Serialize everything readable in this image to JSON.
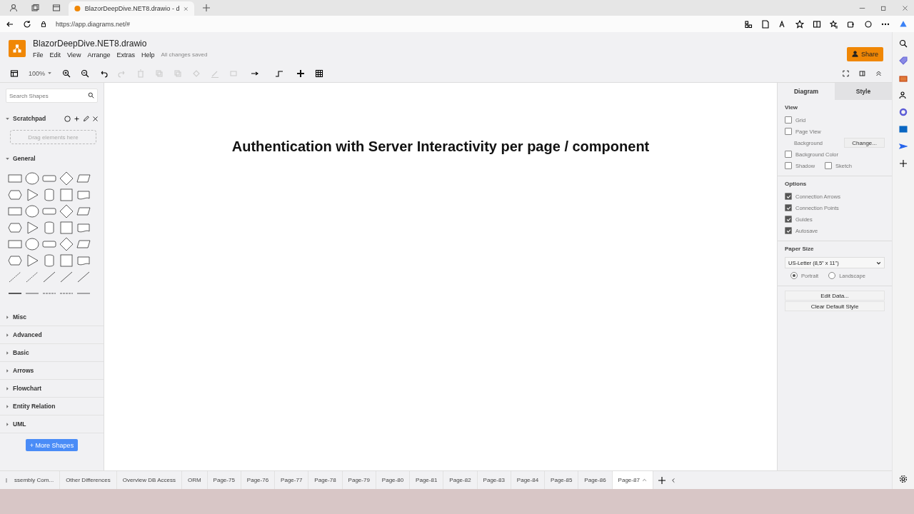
{
  "browser": {
    "tab_title": "BlazorDeepDive.NET8.drawio - d",
    "url": "https://app.diagrams.net/#"
  },
  "app": {
    "title": "BlazorDeepDive.NET8.drawio",
    "menu": [
      "File",
      "Edit",
      "View",
      "Arrange",
      "Extras",
      "Help"
    ],
    "status": "All changes saved",
    "zoom": "100%",
    "share": "Share"
  },
  "sidebar": {
    "search_placeholder": "Search Shapes",
    "scratchpad": {
      "title": "Scratchpad",
      "expanded": true,
      "hint": "Drag elements here"
    },
    "general": {
      "title": "General",
      "expanded": true
    },
    "categories": [
      {
        "label": "Misc",
        "expanded": false
      },
      {
        "label": "Advanced",
        "expanded": false
      },
      {
        "label": "Basic",
        "expanded": false
      },
      {
        "label": "Arrows",
        "expanded": false
      },
      {
        "label": "Flowchart",
        "expanded": false
      },
      {
        "label": "Entity Relation",
        "expanded": false
      },
      {
        "label": "UML",
        "expanded": false
      }
    ],
    "more_shapes": "+ More Shapes"
  },
  "canvas": {
    "heading": "Authentication with Server Interactivity per page / component"
  },
  "format_panel": {
    "tabs": [
      {
        "label": "Diagram",
        "selected": true
      },
      {
        "label": "Style",
        "selected": false
      }
    ],
    "view": {
      "title": "View",
      "rows": [
        [
          {
            "kind": "checkbox",
            "label": "Grid",
            "checked": false
          }
        ],
        [
          {
            "kind": "checkbox",
            "label": "Page View",
            "checked": false
          }
        ],
        [
          {
            "kind": "setting",
            "label": "Background",
            "button": "Change..."
          }
        ],
        [
          {
            "kind": "checkbox",
            "label": "Background Color",
            "checked": false
          }
        ],
        [
          {
            "kind": "checkbox",
            "label": "Shadow",
            "checked": false
          },
          {
            "kind": "checkbox",
            "label": "Sketch",
            "checked": false
          }
        ]
      ]
    },
    "options": {
      "title": "Options",
      "checkboxes": [
        {
          "label": "Connection Arrows",
          "checked": true
        },
        {
          "label": "Connection Points",
          "checked": true
        },
        {
          "label": "Guides",
          "checked": true
        },
        {
          "label": "Autosave",
          "checked": true
        }
      ]
    },
    "paper_size": {
      "title": "Paper Size",
      "value": "US-Letter (8,5\" x 11\")",
      "orientations": [
        {
          "label": "Portrait",
          "selected": true
        },
        {
          "label": "Landscape",
          "selected": false
        }
      ]
    },
    "buttons": [
      "Edit Data...",
      "Clear Default Style"
    ]
  },
  "page_tabs": [
    {
      "label": "ssembly Com...",
      "selected": false
    },
    {
      "label": "Other Differences",
      "selected": false
    },
    {
      "label": "Overview DB Access",
      "selected": false
    },
    {
      "label": "ORM",
      "selected": false
    },
    {
      "label": "Page-75",
      "selected": false
    },
    {
      "label": "Page-76",
      "selected": false
    },
    {
      "label": "Page-77",
      "selected": false
    },
    {
      "label": "Page-78",
      "selected": false
    },
    {
      "label": "Page-79",
      "selected": false
    },
    {
      "label": "Page-80",
      "selected": false
    },
    {
      "label": "Page-81",
      "selected": false
    },
    {
      "label": "Page-82",
      "selected": false
    },
    {
      "label": "Page-83",
      "selected": false
    },
    {
      "label": "Page-84",
      "selected": false
    },
    {
      "label": "Page-85",
      "selected": false
    },
    {
      "label": "Page-86",
      "selected": false
    },
    {
      "label": "Page-87",
      "selected": true
    }
  ]
}
